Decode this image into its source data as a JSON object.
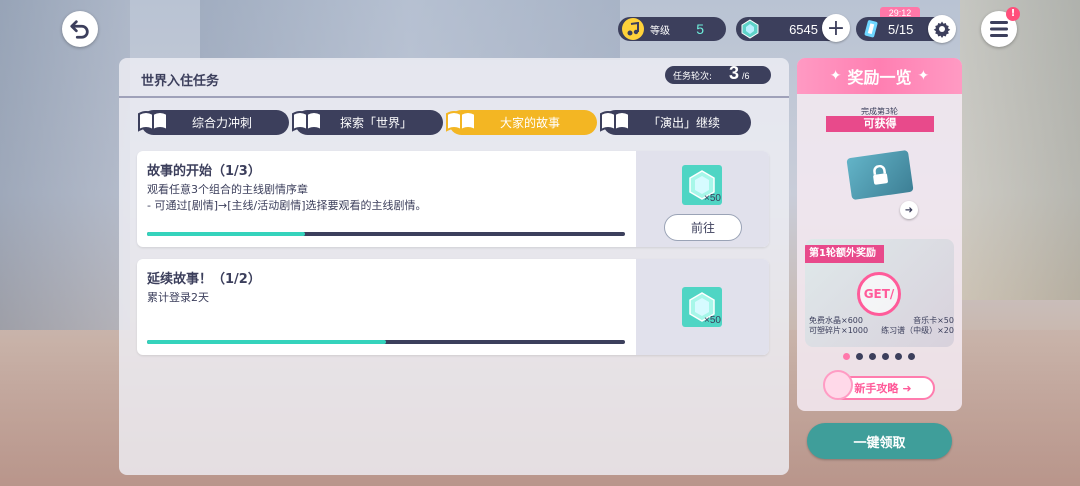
{
  "topbar": {
    "level_label": "等级",
    "level_value": "5",
    "gems": "6545",
    "ap": "5/15",
    "ap_timer": "29:12",
    "menu_badge": "!"
  },
  "panel": {
    "title": "世界入住任务",
    "round_label": "任务轮次:",
    "round_current": "3",
    "round_max": "/6"
  },
  "tabs": [
    {
      "label": "综合力冲刺",
      "active": false
    },
    {
      "label": "探索「世界」",
      "active": false
    },
    {
      "label": "大家的故事",
      "active": true
    },
    {
      "label": "「演出」继续",
      "active": false
    }
  ],
  "missions": [
    {
      "title": "故事的开始（1/3）",
      "desc": "观看任意3个组合的主线剧情序章\n- 可通过[剧情]→[主线/活动剧情]选择要观看的主线剧情。",
      "progress": 0.33,
      "reward_count": "×50",
      "button": "前往"
    },
    {
      "title": "延续故事！（1/2）",
      "desc": "累计登录2天",
      "progress": 0.5,
      "reward_count": "×50"
    }
  ],
  "reward_panel": {
    "header": "奖励一览",
    "ribbon_top": "完成第3轮",
    "ribbon": "可获得",
    "bonus_label": "第1轮额外奖励",
    "get_text": "GET/",
    "bonus_items": [
      {
        "left": "免费水晶×600",
        "right": "音乐卡×50"
      },
      {
        "left": "可塑碎片×1000",
        "right": "练习谱（中级）×20"
      }
    ],
    "dots_count": 6,
    "dots_active": 0,
    "guide": "新手攻略"
  },
  "claim_all": "一键领取",
  "colors": {
    "navy": "#3c3f5c",
    "teal": "#35d3bc",
    "tab_active": "#f3b623",
    "pink": "#ff78ab"
  }
}
